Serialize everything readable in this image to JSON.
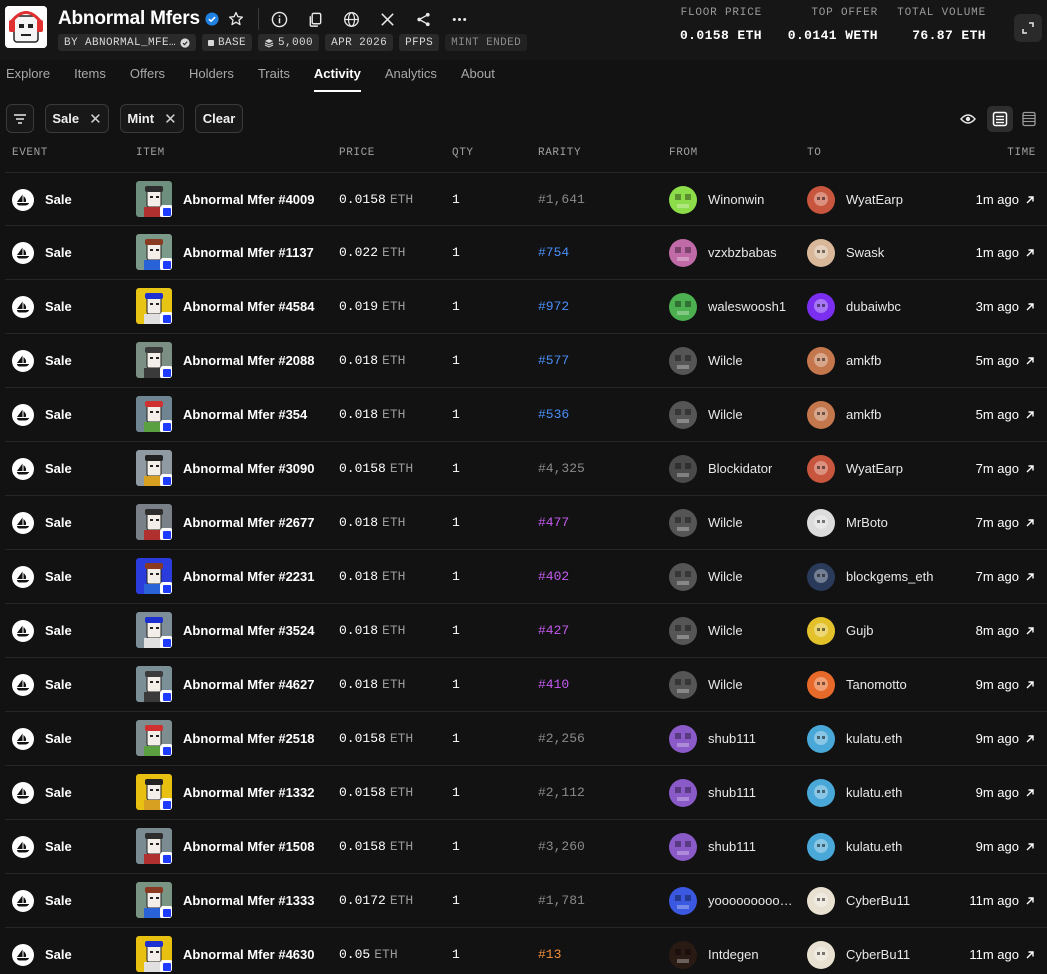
{
  "collection": {
    "title": "Abnormal Mfers",
    "badges": {
      "creator": "BY ABNORMAL_MFE…",
      "chain": "BASE",
      "supply": "5,000",
      "date": "APR 2026",
      "category": "PFPS",
      "mint_status": "MINT ENDED"
    }
  },
  "stats": {
    "floor_label": "FLOOR PRICE",
    "floor_value": "0.0158 ETH",
    "offer_label": "TOP OFFER",
    "offer_value": "0.0141 WETH",
    "volume_label": "TOTAL VOLUME",
    "volume_value": "76.87 ETH"
  },
  "tabs": [
    "Explore",
    "Items",
    "Offers",
    "Holders",
    "Traits",
    "Activity",
    "Analytics",
    "About"
  ],
  "active_tab": "Activity",
  "filters": {
    "chip1": "Sale",
    "chip2": "Mint",
    "clear": "Clear",
    "close_glyph": "✕"
  },
  "table": {
    "headers": {
      "event": "EVENT",
      "item": "ITEM",
      "price": "PRICE",
      "qty": "QTY",
      "rarity": "RARITY",
      "from": "FROM",
      "to": "TO",
      "time": "TIME"
    },
    "rows": [
      {
        "event": "Sale",
        "item": "Abnormal Mfer #4009",
        "price": "0.0158",
        "unit": "ETH",
        "qty": "1",
        "rarity": "#1,641",
        "rarity_color": "#8a8a8a",
        "from": "Winonwin",
        "to": "WyatEarp",
        "time": "1m ago",
        "thumb_bg": "#6f8f7e",
        "from_color": "#8ddc4a",
        "to_color": "#c8553d"
      },
      {
        "event": "Sale",
        "item": "Abnormal Mfer #1137",
        "price": "0.022",
        "unit": "ETH",
        "qty": "1",
        "rarity": "#754",
        "rarity_color": "#4a8ff7",
        "from": "vzxbzbabas",
        "to": "Swask",
        "time": "1m ago",
        "thumb_bg": "#7c9a8a",
        "from_color": "#c06aa8",
        "to_color": "#d9b89a"
      },
      {
        "event": "Sale",
        "item": "Abnormal Mfer #4584",
        "price": "0.019",
        "unit": "ETH",
        "qty": "1",
        "rarity": "#972",
        "rarity_color": "#4a8ff7",
        "from": "waleswoosh1",
        "to": "dubaiwbc",
        "time": "3m ago",
        "thumb_bg": "#e8c414",
        "from_color": "#4caf50",
        "to_color": "#7a2ff0"
      },
      {
        "event": "Sale",
        "item": "Abnormal Mfer #2088",
        "price": "0.018",
        "unit": "ETH",
        "qty": "1",
        "rarity": "#577",
        "rarity_color": "#4a8ff7",
        "from": "Wilcle",
        "to": "amkfb",
        "time": "5m ago",
        "thumb_bg": "#7b8f84",
        "from_color": "#555555",
        "to_color": "#c4774c"
      },
      {
        "event": "Sale",
        "item": "Abnormal Mfer #354",
        "price": "0.018",
        "unit": "ETH",
        "qty": "1",
        "rarity": "#536",
        "rarity_color": "#4a8ff7",
        "from": "Wilcle",
        "to": "amkfb",
        "time": "5m ago",
        "thumb_bg": "#6f8692",
        "from_color": "#555555",
        "to_color": "#c4774c"
      },
      {
        "event": "Sale",
        "item": "Abnormal Mfer #3090",
        "price": "0.0158",
        "unit": "ETH",
        "qty": "1",
        "rarity": "#4,325",
        "rarity_color": "#8a8a8a",
        "from": "Blockidator",
        "to": "WyatEarp",
        "time": "7m ago",
        "thumb_bg": "#8f9aa3",
        "from_color": "#4a4a4a",
        "to_color": "#c8553d"
      },
      {
        "event": "Sale",
        "item": "Abnormal Mfer #2677",
        "price": "0.018",
        "unit": "ETH",
        "qty": "1",
        "rarity": "#477",
        "rarity_color": "#c45cf0",
        "from": "Wilcle",
        "to": "MrBoto",
        "time": "7m ago",
        "thumb_bg": "#7a8088",
        "from_color": "#555555",
        "to_color": "#dcdcdc"
      },
      {
        "event": "Sale",
        "item": "Abnormal Mfer #2231",
        "price": "0.018",
        "unit": "ETH",
        "qty": "1",
        "rarity": "#402",
        "rarity_color": "#c45cf0",
        "from": "Wilcle",
        "to": "blockgems_eth",
        "time": "7m ago",
        "thumb_bg": "#2a3cdc",
        "from_color": "#555555",
        "to_color": "#2a3a5a"
      },
      {
        "event": "Sale",
        "item": "Abnormal Mfer #3524",
        "price": "0.018",
        "unit": "ETH",
        "qty": "1",
        "rarity": "#427",
        "rarity_color": "#c45cf0",
        "from": "Wilcle",
        "to": "Gujb",
        "time": "8m ago",
        "thumb_bg": "#7d8e98",
        "from_color": "#555555",
        "to_color": "#e3c12a"
      },
      {
        "event": "Sale",
        "item": "Abnormal Mfer #4627",
        "price": "0.018",
        "unit": "ETH",
        "qty": "1",
        "rarity": "#410",
        "rarity_color": "#c45cf0",
        "from": "Wilcle",
        "to": "Tanomotto",
        "time": "9m ago",
        "thumb_bg": "#7b8f96",
        "from_color": "#555555",
        "to_color": "#e86a2a"
      },
      {
        "event": "Sale",
        "item": "Abnormal Mfer #2518",
        "price": "0.0158",
        "unit": "ETH",
        "qty": "1",
        "rarity": "#2,256",
        "rarity_color": "#8a8a8a",
        "from": "shub111",
        "to": "kulatu.eth",
        "time": "9m ago",
        "thumb_bg": "#7e8d90",
        "from_color": "#8a5ac8",
        "to_color": "#4aa8d8"
      },
      {
        "event": "Sale",
        "item": "Abnormal Mfer #1332",
        "price": "0.0158",
        "unit": "ETH",
        "qty": "1",
        "rarity": "#2,112",
        "rarity_color": "#8a8a8a",
        "from": "shub111",
        "to": "kulatu.eth",
        "time": "9m ago",
        "thumb_bg": "#e8c010",
        "from_color": "#8a5ac8",
        "to_color": "#4aa8d8"
      },
      {
        "event": "Sale",
        "item": "Abnormal Mfer #1508",
        "price": "0.0158",
        "unit": "ETH",
        "qty": "1",
        "rarity": "#3,260",
        "rarity_color": "#8a8a8a",
        "from": "shub111",
        "to": "kulatu.eth",
        "time": "9m ago",
        "thumb_bg": "#7a8c92",
        "from_color": "#8a5ac8",
        "to_color": "#4aa8d8"
      },
      {
        "event": "Sale",
        "item": "Abnormal Mfer #1333",
        "price": "0.0172",
        "unit": "ETH",
        "qty": "1",
        "rarity": "#1,781",
        "rarity_color": "#8a8a8a",
        "from": "yooooooooo…",
        "to": "CyberBu11",
        "time": "11m ago",
        "thumb_bg": "#7a9484",
        "from_color": "#3a58e0",
        "to_color": "#e8e0d0"
      },
      {
        "event": "Sale",
        "item": "Abnormal Mfer #4630",
        "price": "0.05",
        "unit": "ETH",
        "qty": "1",
        "rarity": "#13",
        "rarity_color": "#f0903a",
        "from": "Intdegen",
        "to": "CyberBu11",
        "time": "11m ago",
        "thumb_bg": "#e8c010",
        "from_color": "#2a1a14",
        "to_color": "#e8e0d0"
      }
    ]
  },
  "colors": {
    "background": "#121212",
    "link_blue": "#4a8ff7",
    "epic_purple": "#c45cf0",
    "legendary_orange": "#f0903a",
    "verified_blue": "#2081e2"
  },
  "icons": {
    "verified": "verified-badge-icon",
    "favorite": "star-icon",
    "info": "info-icon",
    "copy": "copy-icon",
    "website": "globe-icon",
    "x": "x-logo-icon",
    "share": "share-icon",
    "more": "more-icon",
    "expand": "expand-icon",
    "filter": "filter-icon",
    "visibility": "eye-icon",
    "list_view": "list-view-icon",
    "table_view": "table-view-icon",
    "sale_event": "opensea-sale-icon",
    "external": "arrow-up-right-icon"
  }
}
